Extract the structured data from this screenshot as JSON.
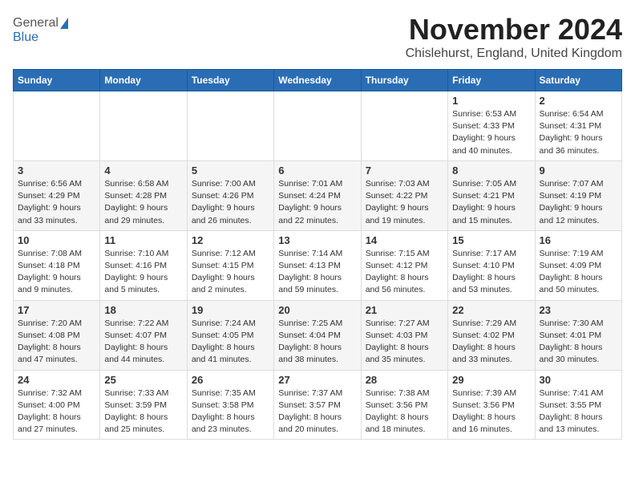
{
  "header": {
    "logo_general": "General",
    "logo_blue": "Blue",
    "month_title": "November 2024",
    "location": "Chislehurst, England, United Kingdom"
  },
  "days_of_week": [
    "Sunday",
    "Monday",
    "Tuesday",
    "Wednesday",
    "Thursday",
    "Friday",
    "Saturday"
  ],
  "weeks": [
    [
      {
        "day": "",
        "info": ""
      },
      {
        "day": "",
        "info": ""
      },
      {
        "day": "",
        "info": ""
      },
      {
        "day": "",
        "info": ""
      },
      {
        "day": "",
        "info": ""
      },
      {
        "day": "1",
        "info": "Sunrise: 6:53 AM\nSunset: 4:33 PM\nDaylight: 9 hours and 40 minutes."
      },
      {
        "day": "2",
        "info": "Sunrise: 6:54 AM\nSunset: 4:31 PM\nDaylight: 9 hours and 36 minutes."
      }
    ],
    [
      {
        "day": "3",
        "info": "Sunrise: 6:56 AM\nSunset: 4:29 PM\nDaylight: 9 hours and 33 minutes."
      },
      {
        "day": "4",
        "info": "Sunrise: 6:58 AM\nSunset: 4:28 PM\nDaylight: 9 hours and 29 minutes."
      },
      {
        "day": "5",
        "info": "Sunrise: 7:00 AM\nSunset: 4:26 PM\nDaylight: 9 hours and 26 minutes."
      },
      {
        "day": "6",
        "info": "Sunrise: 7:01 AM\nSunset: 4:24 PM\nDaylight: 9 hours and 22 minutes."
      },
      {
        "day": "7",
        "info": "Sunrise: 7:03 AM\nSunset: 4:22 PM\nDaylight: 9 hours and 19 minutes."
      },
      {
        "day": "8",
        "info": "Sunrise: 7:05 AM\nSunset: 4:21 PM\nDaylight: 9 hours and 15 minutes."
      },
      {
        "day": "9",
        "info": "Sunrise: 7:07 AM\nSunset: 4:19 PM\nDaylight: 9 hours and 12 minutes."
      }
    ],
    [
      {
        "day": "10",
        "info": "Sunrise: 7:08 AM\nSunset: 4:18 PM\nDaylight: 9 hours and 9 minutes."
      },
      {
        "day": "11",
        "info": "Sunrise: 7:10 AM\nSunset: 4:16 PM\nDaylight: 9 hours and 5 minutes."
      },
      {
        "day": "12",
        "info": "Sunrise: 7:12 AM\nSunset: 4:15 PM\nDaylight: 9 hours and 2 minutes."
      },
      {
        "day": "13",
        "info": "Sunrise: 7:14 AM\nSunset: 4:13 PM\nDaylight: 8 hours and 59 minutes."
      },
      {
        "day": "14",
        "info": "Sunrise: 7:15 AM\nSunset: 4:12 PM\nDaylight: 8 hours and 56 minutes."
      },
      {
        "day": "15",
        "info": "Sunrise: 7:17 AM\nSunset: 4:10 PM\nDaylight: 8 hours and 53 minutes."
      },
      {
        "day": "16",
        "info": "Sunrise: 7:19 AM\nSunset: 4:09 PM\nDaylight: 8 hours and 50 minutes."
      }
    ],
    [
      {
        "day": "17",
        "info": "Sunrise: 7:20 AM\nSunset: 4:08 PM\nDaylight: 8 hours and 47 minutes."
      },
      {
        "day": "18",
        "info": "Sunrise: 7:22 AM\nSunset: 4:07 PM\nDaylight: 8 hours and 44 minutes."
      },
      {
        "day": "19",
        "info": "Sunrise: 7:24 AM\nSunset: 4:05 PM\nDaylight: 8 hours and 41 minutes."
      },
      {
        "day": "20",
        "info": "Sunrise: 7:25 AM\nSunset: 4:04 PM\nDaylight: 8 hours and 38 minutes."
      },
      {
        "day": "21",
        "info": "Sunrise: 7:27 AM\nSunset: 4:03 PM\nDaylight: 8 hours and 35 minutes."
      },
      {
        "day": "22",
        "info": "Sunrise: 7:29 AM\nSunset: 4:02 PM\nDaylight: 8 hours and 33 minutes."
      },
      {
        "day": "23",
        "info": "Sunrise: 7:30 AM\nSunset: 4:01 PM\nDaylight: 8 hours and 30 minutes."
      }
    ],
    [
      {
        "day": "24",
        "info": "Sunrise: 7:32 AM\nSunset: 4:00 PM\nDaylight: 8 hours and 27 minutes."
      },
      {
        "day": "25",
        "info": "Sunrise: 7:33 AM\nSunset: 3:59 PM\nDaylight: 8 hours and 25 minutes."
      },
      {
        "day": "26",
        "info": "Sunrise: 7:35 AM\nSunset: 3:58 PM\nDaylight: 8 hours and 23 minutes."
      },
      {
        "day": "27",
        "info": "Sunrise: 7:37 AM\nSunset: 3:57 PM\nDaylight: 8 hours and 20 minutes."
      },
      {
        "day": "28",
        "info": "Sunrise: 7:38 AM\nSunset: 3:56 PM\nDaylight: 8 hours and 18 minutes."
      },
      {
        "day": "29",
        "info": "Sunrise: 7:39 AM\nSunset: 3:56 PM\nDaylight: 8 hours and 16 minutes."
      },
      {
        "day": "30",
        "info": "Sunrise: 7:41 AM\nSunset: 3:55 PM\nDaylight: 8 hours and 13 minutes."
      }
    ]
  ]
}
